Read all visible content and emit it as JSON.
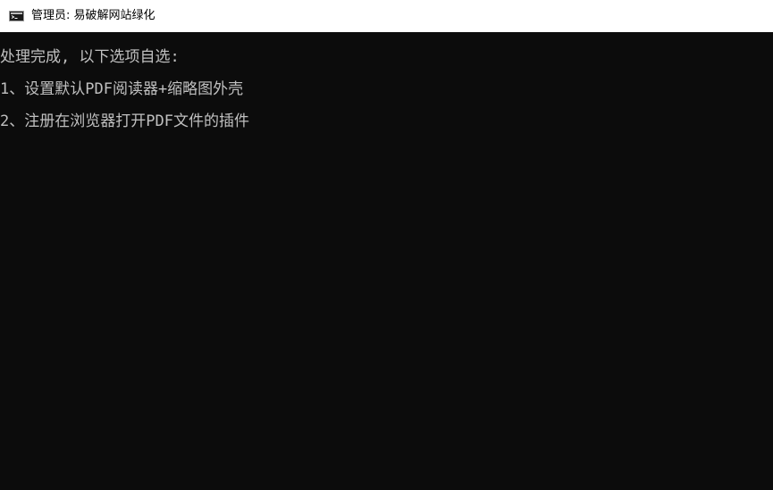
{
  "window": {
    "title": "管理员:  易破解网站绿化",
    "icon": "cmd-console-icon"
  },
  "console": {
    "lines": [
      "处理完成, 以下选项自选:",
      "1、设置默认PDF阅读器+缩略图外壳",
      "2、注册在浏览器打开PDF文件的插件"
    ]
  },
  "colors": {
    "background": "#0c0c0c",
    "text": "#c0c0c0",
    "titlebar": "#ffffff"
  }
}
